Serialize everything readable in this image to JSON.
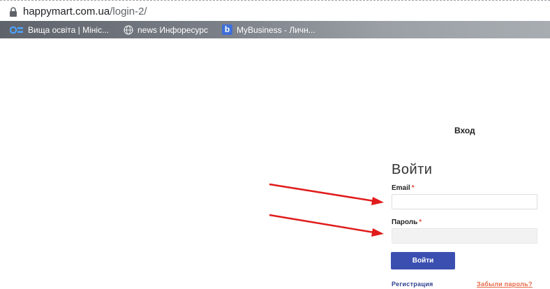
{
  "browser": {
    "url_host": "happymart.com.ua",
    "url_path": "/login-2/",
    "bookmarks": [
      {
        "label": "Вища освіта | Мініс...",
        "icon": "osvita-icon"
      },
      {
        "label": "news Инфоресурс",
        "icon": "globe-icon"
      },
      {
        "label": "MyBusiness - Личн...",
        "icon": "mybusiness-icon",
        "icon_letter": "b"
      }
    ]
  },
  "page": {
    "title": "Вход",
    "form": {
      "heading": "Войти",
      "email_label": "Email",
      "password_label": "Пароль",
      "required_mark": "*",
      "email_value": "",
      "password_value": "",
      "submit_label": "Войти",
      "register_link": "Регистрация",
      "forgot_link": "Забыли пароль?"
    }
  },
  "colors": {
    "annotation_arrow": "#e01b1b",
    "button": "#3a4fb0",
    "link": "#2f3f8f",
    "forgot_link": "#e86a4a",
    "required": "#e74c3c"
  }
}
